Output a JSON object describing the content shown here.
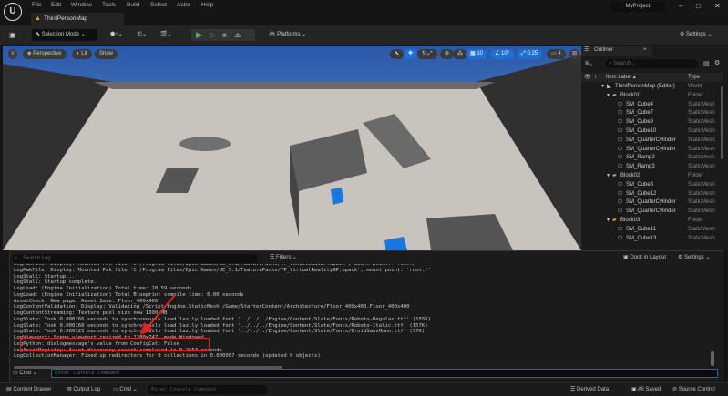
{
  "app": {
    "logo": "U",
    "project": "MyProject",
    "tab": "ThirdPersonMap",
    "menu": [
      "File",
      "Edit",
      "Window",
      "Tools",
      "Build",
      "Select",
      "Actor",
      "Help"
    ]
  },
  "toolbar": {
    "selection_mode": "Selection Mode",
    "platforms": "Platforms",
    "settings": "Settings"
  },
  "viewport": {
    "perspective": "Perspective",
    "lit": "Lit",
    "show": "Show",
    "grid_snap": "10",
    "rot_snap": "10°",
    "scale_snap": "0.25",
    "camera_speed": "4"
  },
  "outliner": {
    "title": "Outliner",
    "search_placeholder": "Search...",
    "col_label": "Item Label",
    "col_type": "Type",
    "rows": [
      {
        "label": "ThirdPersonMap (Editor)",
        "type": "World",
        "level": 0,
        "icon": "world"
      },
      {
        "label": "Block01",
        "type": "Folder",
        "level": 1,
        "icon": "folder"
      },
      {
        "label": "SM_Cube4",
        "type": "StaticMesh",
        "level": 2,
        "icon": "mesh"
      },
      {
        "label": "SM_Cube7",
        "type": "StaticMesh",
        "level": 2,
        "icon": "mesh"
      },
      {
        "label": "SM_Cube9",
        "type": "StaticMesh",
        "level": 2,
        "icon": "mesh"
      },
      {
        "label": "SM_Cube10",
        "type": "StaticMesh",
        "level": 2,
        "icon": "mesh"
      },
      {
        "label": "SM_QuarterCylinder",
        "type": "StaticMesh",
        "level": 2,
        "icon": "mesh"
      },
      {
        "label": "SM_QuarterCylinder",
        "type": "StaticMesh",
        "level": 2,
        "icon": "mesh"
      },
      {
        "label": "SM_Ramp2",
        "type": "StaticMesh",
        "level": 2,
        "icon": "mesh"
      },
      {
        "label": "SM_Ramp3",
        "type": "StaticMesh",
        "level": 2,
        "icon": "mesh"
      },
      {
        "label": "Block02",
        "type": "Folder",
        "level": 1,
        "icon": "folder"
      },
      {
        "label": "SM_Cube8",
        "type": "StaticMesh",
        "level": 2,
        "icon": "mesh"
      },
      {
        "label": "SM_Cube12",
        "type": "StaticMesh",
        "level": 2,
        "icon": "mesh"
      },
      {
        "label": "SM_QuarterCylinder",
        "type": "StaticMesh",
        "level": 2,
        "icon": "mesh"
      },
      {
        "label": "SM_QuarterCylinder",
        "type": "StaticMesh",
        "level": 2,
        "icon": "mesh"
      },
      {
        "label": "Block03",
        "type": "Folder",
        "level": 1,
        "icon": "folder"
      },
      {
        "label": "SM_Cube11",
        "type": "StaticMesh",
        "level": 2,
        "icon": "mesh"
      },
      {
        "label": "SM_Cube13",
        "type": "StaticMesh",
        "level": 2,
        "icon": "mesh"
      }
    ]
  },
  "log": {
    "search_placeholder": "Search Log",
    "filters": "Filters",
    "dock": "Dock in Layout",
    "settings": "Settings",
    "lines": [
      "LogPakFile: Display: Mounted Pak file 'C:/Program Files/Epic Games/UE_5.1/FeaturePacks/TP_VehicleAdvBP.upack', mount point: 'root:/'",
      "LogPakFile: Display: Mounted Pak file 'C:/Program Files/Epic Games/UE_5.1/FeaturePacks/TP_VirtualRealityBP.upack', mount point: 'root:/'",
      "LogStall: Startup...",
      "LogStall: Startup complete.",
      "LogLoad: (Engine Initialization) Total time: 10.59 seconds",
      "LogLoad: (Engine Initialization) Total Blueprint compile time: 0.00 seconds",
      "AssetCheck: New page: Asset Save: Floor_400x400",
      "LogContentValidation: Display: Validating /Script/Engine.StaticMesh /Game/StarterContent/Architecture/Floor_400x400.Floor_400x400",
      "LogContentStreaming: Texture pool size now 1000 MB",
      "LogSlate: Took 0.000166 seconds to synchronously load lazily loaded font '../../../Engine/Content/Slate/Fonts/Roboto-Regular.ttf' (155K)",
      "LogSlate: Took 0.000160 seconds to synchronously load lazily loaded font '../../../Engine/Content/Slate/Fonts/Roboto-Italic.ttf' (157K)",
      "LogSlate: Took 0.000123 seconds to synchronously load lazily loaded font '../../../Engine/Content/Slate/Fonts/DroidSansMono.ttf' (77K)",
      "LogViewport: Scene viewport resized to 1280x747, mode Windowed.",
      "LogPython: dialogmessage's value from ConfigCat: False",
      "LogAssetRegistry: Asset discovery search completed in 0.2553 seconds",
      "LogCollectionManager: Fixed up redirectors for 0 collections in 0.000007 seconds (updated 0 objects)"
    ],
    "cmd": "Cmd",
    "cmd_placeholder": "Enter Console Command"
  },
  "statusbar": {
    "content_drawer": "Content Drawer",
    "output_log": "Output Log",
    "cmd": "Cmd",
    "cmd_placeholder": "Enter Console Command",
    "derived_data": "Derived Data",
    "all_saved": "All Saved",
    "source_control": "Source Control"
  },
  "colors": {
    "accent": "#1e6fd6",
    "highlight": "#e52020",
    "play": "#4caf50"
  }
}
